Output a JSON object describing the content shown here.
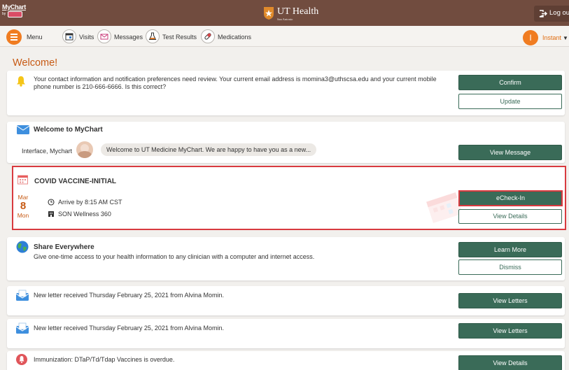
{
  "topbar": {
    "logo_text": "MyChart",
    "logo_by": "by",
    "logo_epic": "Epic",
    "brand_title": "UT Health",
    "brand_subtitle": "San Antonio",
    "logout_label": "Log out"
  },
  "menubar": {
    "menu_label": "Menu",
    "items": [
      {
        "label": "Visits",
        "icon": "calendar-icon"
      },
      {
        "label": "Messages",
        "icon": "envelope-icon"
      },
      {
        "label": "Test Results",
        "icon": "flask-icon"
      },
      {
        "label": "Medications",
        "icon": "pill-icon"
      }
    ],
    "user_initial": "I",
    "user_name": "Instant",
    "user_caret": "▼"
  },
  "page": {
    "title": "Welcome!"
  },
  "cards": {
    "contact": {
      "text": "Your contact information and notification preferences need review. Your current email address is momina3@uthscsa.edu and your current mobile phone number is 210-666-6666. Is this correct?",
      "confirm_label": "Confirm",
      "update_label": "Update"
    },
    "welcome_msg": {
      "title": "Welcome to MyChart",
      "sender": "Interface, Mychart",
      "preview": "Welcome to UT Medicine MyChart. We are happy to have you as a new...",
      "button_label": "View Message"
    },
    "appointment": {
      "title": "COVID VACCINE-INITIAL",
      "month": "Mar",
      "day": "8",
      "weekday": "Mon",
      "arrive": "Arrive by 8:15 AM CST",
      "location": "SON Wellness 360",
      "echeckin_label": "eCheck-In",
      "details_label": "View Details"
    },
    "share": {
      "title": "Share Everywhere",
      "text": "Give one-time access to your health information to any clinician with a computer and internet access.",
      "learn_label": "Learn More",
      "dismiss_label": "Dismiss"
    },
    "letter1": {
      "text": "New letter received Thursday February 25, 2021 from Alvina Momin.",
      "button_label": "View Letters"
    },
    "letter2": {
      "text": "New letter received Thursday February 25, 2021 from Alvina Momin.",
      "button_label": "View Letters"
    },
    "immunization": {
      "text": "Immunization: DTaP/Td/Tdap Vaccines is overdue.",
      "button_label": "View Details"
    }
  },
  "colors": {
    "topbar": "#714c3f",
    "accent_orange": "#f07c21",
    "button_green": "#3a6b58",
    "highlight_red": "#d83a3f",
    "welcome_title": "#c75a14"
  }
}
